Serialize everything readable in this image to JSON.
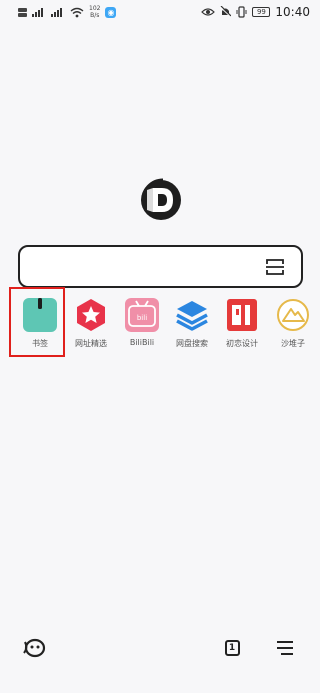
{
  "status_bar": {
    "net_speed": "102",
    "net_unit": "B/s",
    "battery": "99",
    "time": "10:40"
  },
  "search": {
    "placeholder": ""
  },
  "shortcuts": [
    {
      "label": "书签",
      "icon": "bookmark-icon",
      "color": "#5ec6b4"
    },
    {
      "label": "网址精选",
      "icon": "star-hexagon-icon",
      "color": "#e8334a"
    },
    {
      "label": "BiliBili",
      "icon": "bilibili-icon",
      "color": "#f08fa8"
    },
    {
      "label": "网盘搜索",
      "icon": "layers-icon",
      "color": "#2b86e0"
    },
    {
      "label": "初恋设计",
      "icon": "pi-logo-icon",
      "color": "#e53a3a"
    },
    {
      "label": "沙堆子",
      "icon": "sand-hill-icon",
      "color": "#e6b94a"
    }
  ],
  "bottom_bar": {
    "tab_count": "1"
  },
  "colors": {
    "highlight": "#e0201c",
    "background": "#f7f7f9"
  }
}
